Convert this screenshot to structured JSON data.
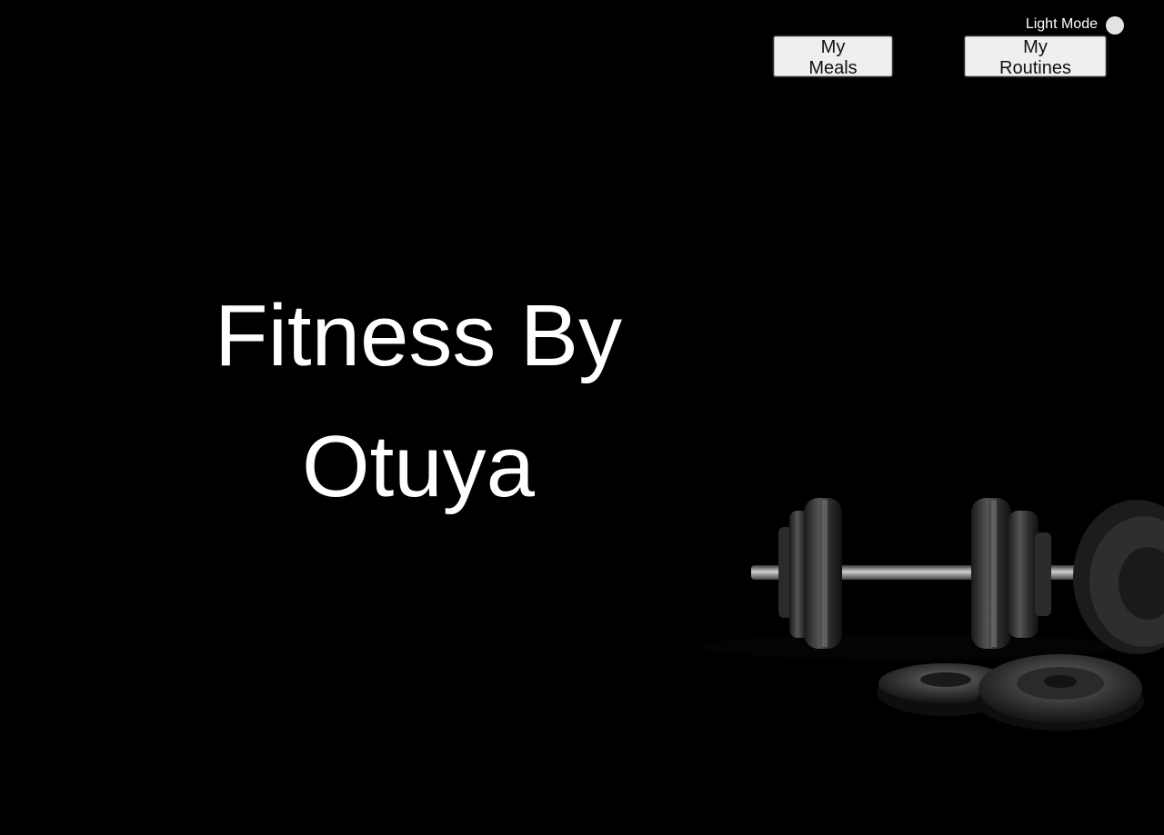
{
  "header": {
    "theme_toggle_label": "Light Mode",
    "meals_button_label": "My Meals",
    "routines_button_label": "My Routines"
  },
  "hero": {
    "title": "Fitness By Otuya"
  },
  "background": {
    "image_subject": "dumbbell and weight plates on dark floor",
    "colors": {
      "page": "#000000",
      "text": "#ffffff",
      "button": "#efefef",
      "knob": "#e3e3e3"
    }
  },
  "icons": {
    "toggle": "toggle-knob-icon"
  }
}
